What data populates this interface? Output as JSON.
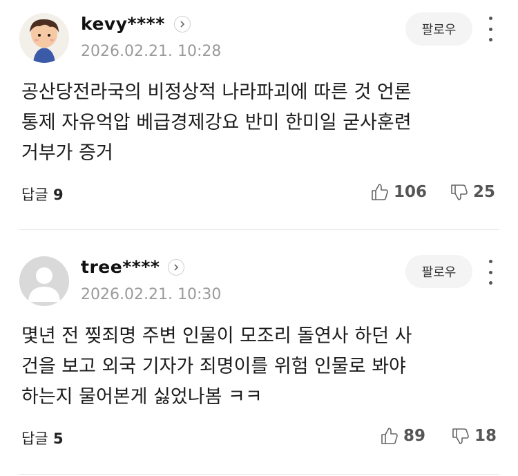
{
  "comments": [
    {
      "username": "kevy****",
      "date": "2026.02.21. 10:28",
      "follow_label": "팔로우",
      "text_lines": [
        "공산당전라국의 비정상적 나라파괴에 따른 것 언론",
        "통제 자유억압 베급경제강요 반미 한미일 굳사훈련",
        "거부가 증거"
      ],
      "reply_label": "답글",
      "reply_count": "9",
      "likes": "106",
      "dislikes": "25"
    },
    {
      "username": "tree****",
      "date": "2026.02.21. 10:30",
      "follow_label": "팔로우",
      "text_lines": [
        "몇년 전 찢죄명 주변 인물이 모조리 돌연사 하던 사",
        "건을 보고 외국 기자가 죄명이를 위험 인물로 봐야",
        "하는지 물어본게 싫었나봄 ㅋㅋ"
      ],
      "reply_label": "답글",
      "reply_count": "5",
      "likes": "89",
      "dislikes": "18"
    }
  ],
  "icons": {
    "profile_arrow": "chevron-right-icon",
    "more": "more-vertical-icon",
    "like": "thumbs-up-icon",
    "dislike": "thumbs-down-icon"
  }
}
